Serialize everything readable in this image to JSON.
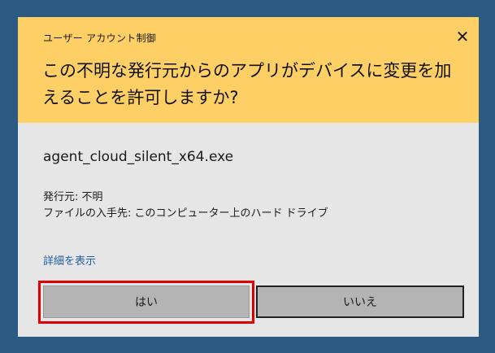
{
  "dialog": {
    "title": "ユーザー アカウント制御",
    "close_label": "✕",
    "question": "この不明な発行元からのアプリがデバイスに変更を加えることを許可しますか?",
    "program_name": "agent_cloud_silent_x64.exe",
    "publisher_line": "発行元: 不明",
    "origin_line": "ファイルの入手先: このコンピューター上のハード ドライブ",
    "more_details_label": "詳細を表示",
    "yes_label": "はい",
    "no_label": "いいえ"
  },
  "colors": {
    "header_bg": "#fdcf64",
    "body_bg": "#e6e6e6",
    "desktop_bg": "#2b5a82",
    "link": "#1f5fa8",
    "highlight": "#e10000"
  },
  "icons": {
    "close": "close-icon"
  }
}
